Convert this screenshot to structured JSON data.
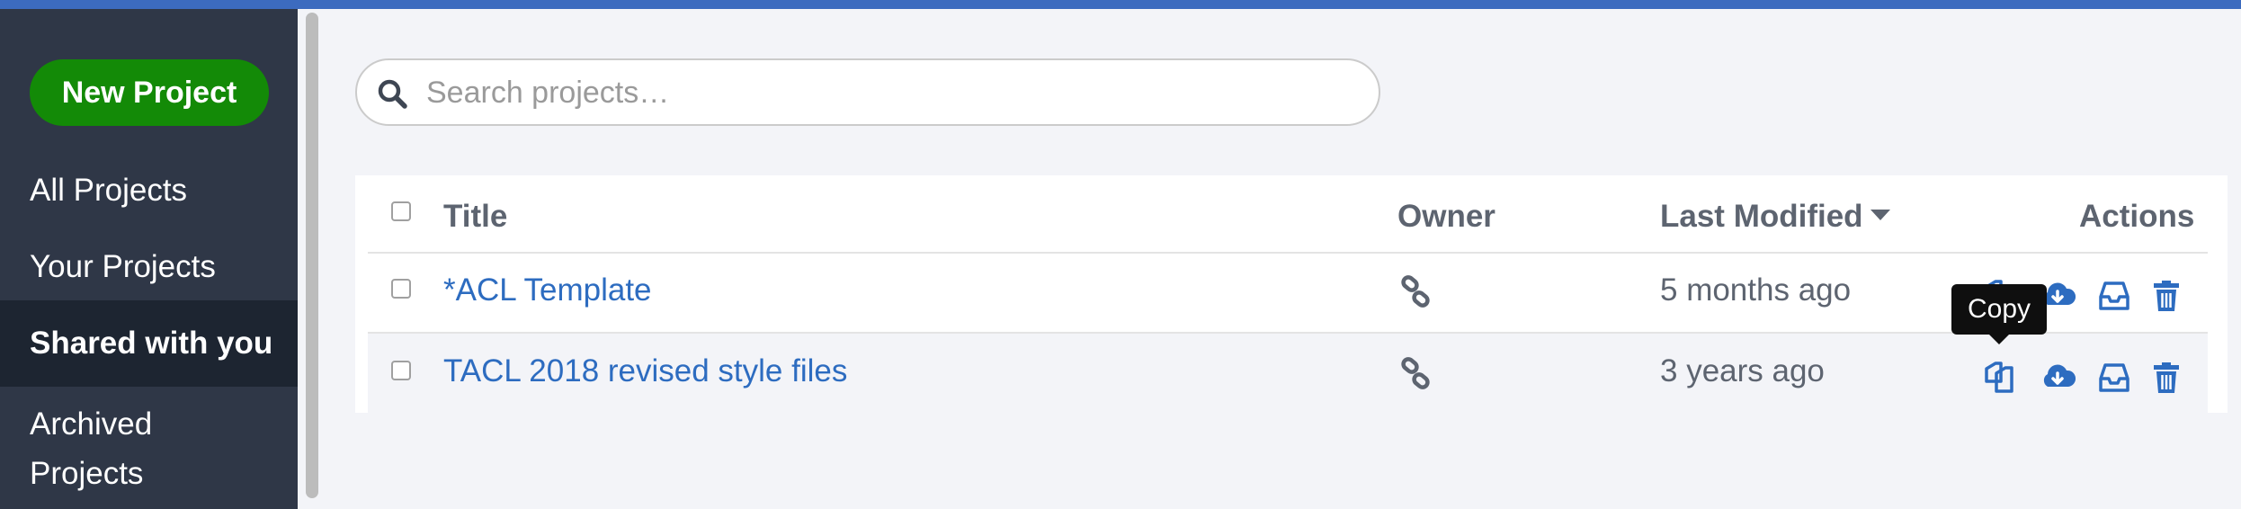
{
  "sidebar": {
    "new_project_label": "New Project",
    "items": [
      {
        "label": "All Projects"
      },
      {
        "label": "Your Projects"
      },
      {
        "label": "Shared with you",
        "active": true
      },
      {
        "label_line1": "Archived",
        "label_line2": "Projects"
      }
    ]
  },
  "search": {
    "placeholder": "Search projects…",
    "value": ""
  },
  "table": {
    "headers": {
      "title": "Title",
      "owner": "Owner",
      "last_modified": "Last Modified",
      "actions": "Actions"
    },
    "sort": {
      "column": "Last Modified",
      "direction": "descending"
    },
    "rows": [
      {
        "title": "*ACL Template",
        "owner_icon": "link-icon",
        "last_modified": "5 months ago"
      },
      {
        "title": "TACL 2018 revised style files",
        "owner_icon": "link-icon",
        "last_modified": "3 years ago"
      }
    ],
    "action_icons": [
      "copy-icon",
      "download-icon",
      "archive-icon",
      "trash-icon"
    ]
  },
  "tooltip": {
    "text": "Copy"
  },
  "colors": {
    "accent": "#3c6bbf",
    "new_project_bg": "#138a07",
    "sidebar_bg": "#2f3747",
    "sidebar_active_bg": "#1d2531",
    "link": "#2d6cc0",
    "action_icon": "#2d6cc0"
  }
}
